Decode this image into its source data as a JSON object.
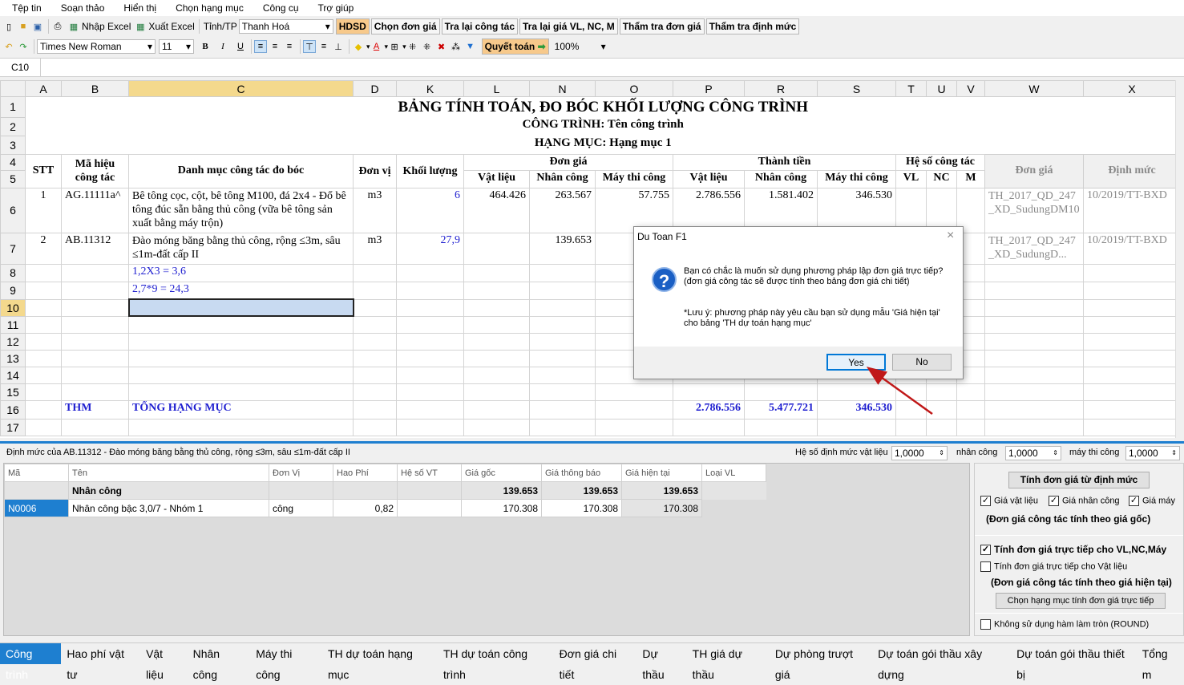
{
  "menu": [
    "Tệp tin",
    "Soạn thảo",
    "Hiển thị",
    "Chọn hạng mục",
    "Công cụ",
    "Trợ giúp"
  ],
  "toolbar1": {
    "import_excel": "Nhập Excel",
    "export_excel": "Xuất Excel",
    "province_label": "Tỉnh/TP",
    "province_value": "Thanh Hoá",
    "buttons": [
      "HDSD",
      "Chọn đơn giá",
      "Tra lại công tác",
      "Tra lại giá VL, NC, M",
      "Thẩm tra đơn giá",
      "Thẩm tra định mức"
    ]
  },
  "toolbar2": {
    "font": "Times New Roman",
    "size": "11",
    "bold": "B",
    "italic": "I",
    "underline": "U",
    "settle": "Quyết toán",
    "zoom": "100%"
  },
  "cell_ref": "C10",
  "columns": [
    "A",
    "B",
    "C",
    "D",
    "K",
    "L",
    "N",
    "O",
    "P",
    "R",
    "S",
    "T",
    "U",
    "V",
    "W",
    "X"
  ],
  "rows": [
    "1",
    "2",
    "3",
    "4",
    "5",
    "6",
    "7",
    "8",
    "9",
    "10",
    "11",
    "12",
    "13",
    "14",
    "15",
    "16",
    "17"
  ],
  "sheet": {
    "title": "BẢNG TÍNH TOÁN, ĐO BÓC KHỐI LƯỢNG CÔNG TRÌNH",
    "project": "CÔNG TRÌNH: Tên công trình",
    "category": "HẠNG MỤC: Hạng mục 1",
    "h": {
      "stt": "STT",
      "code": "Mã hiệu công tác",
      "name": "Danh mục công tác đo bóc",
      "unit": "Đơn vị",
      "qty": "Khối lượng",
      "unit_price": "Đơn giá",
      "amount": "Thành tiền",
      "coef": "Hệ số công tác",
      "vl": "Vật liệu",
      "nc": "Nhân công",
      "m": "Máy thi công",
      "cvl": "VL",
      "cnc": "NC",
      "cm": "M",
      "w": "Đơn giá",
      "x": "Định mức"
    },
    "r1": {
      "stt": "1",
      "code": "AG.11111a^",
      "name": "Bê tông cọc, cột, bê tông M100, đá 2x4 - Đổ bê tông đúc sẵn bằng thủ công (vữa bê tông sản xuất bằng máy trộn)",
      "unit": "m3",
      "qty": "6",
      "vl": "464.426",
      "nc": "263.567",
      "m": "57.755",
      "tvl": "2.786.556",
      "tnc": "1.581.402",
      "tm": "346.530",
      "w": "TH_2017_QD_247_XD_SudungDM10",
      "x": "10/2019/TT-BXD"
    },
    "r2": {
      "stt": "2",
      "code": "AB.11312",
      "name": "Đào móng băng bằng thủ công, rộng ≤3m, sâu ≤1m-đất cấp II",
      "unit": "m3",
      "qty": "27,9",
      "nc": "139.653",
      "w": "TH_2017_QD_247_XD_SudungD...",
      "x": "10/2019/TT-BXD"
    },
    "r8": "1,2X3 = 3,6",
    "r9": "2,7*9 = 24,3",
    "total": {
      "code": "THM",
      "name": "TỔNG HẠNG MỤC",
      "vl": "2.786.556",
      "nc": "5.477.721",
      "m": "346.530"
    }
  },
  "dialog": {
    "title": "Du Toan F1",
    "message": "Bạn có chắc là muốn sử dụng phương pháp lập đơn giá trực tiếp? (đơn giá công tác sẽ được tính theo bảng đơn giá chi tiết)",
    "note": "*Lưu ý: phương pháp này yêu cầu bạn sử dụng mẫu 'Giá hiện tại' cho bảng 'TH dự toán hạng mục'",
    "yes": "Yes",
    "no": "No"
  },
  "detail": {
    "caption": "Định mức của AB.11312 - Đào móng băng bằng thủ công, rộng ≤3m, sâu ≤1m-đất cấp II",
    "coef_vl_label": "Hệ số định mức vật liệu",
    "coef_vl": "1,0000",
    "coef_nc_label": "nhân công",
    "coef_nc": "1,0000",
    "coef_m_label": "máy thi công",
    "coef_m": "1,0000",
    "cols": [
      "Mã",
      "Tên",
      "Đơn Vị",
      "Hao Phí",
      "Hệ số VT",
      "Giá gốc",
      "Giá thông báo",
      "Giá hiện tại",
      "Loại VL"
    ],
    "group": {
      "name": "Nhân công",
      "p1": "139.653",
      "p2": "139.653",
      "p3": "139.653"
    },
    "row": {
      "code": "N0006",
      "name": "Nhân công bậc 3,0/7 - Nhóm 1",
      "unit": "công",
      "hp": "0,82",
      "p1": "170.308",
      "p2": "170.308",
      "p3": "170.308"
    }
  },
  "right": {
    "calc_btn": "Tính đơn giá từ định mức",
    "c1": "Giá vật liệu",
    "c2": "Giá nhân công",
    "c3": "Giá máy",
    "note1": "(Đơn giá công tác tính theo giá gốc)",
    "direct": "Tính đơn giá trực tiếp cho VL,NC,Máy",
    "direct_vl": "Tính đơn giá trực tiếp cho Vật liệu",
    "note2": "(Đơn giá công tác tính theo giá hiện tại)",
    "choose_btn": "Chọn hạng mục tính đơn giá trực tiếp",
    "round": "Không sử dụng hàm làm tròn (ROUND)"
  },
  "tabs": [
    "Công trình",
    "Hao phí vật tư",
    "Vật liệu",
    "Nhân công",
    "Máy thi công",
    "TH dự toán hạng mục",
    "TH dự toán công trình",
    "Đơn giá chi tiết",
    "Dự thầu",
    "TH giá dự thầu",
    "Dự phòng trượt giá",
    "Dự toán gói thầu xây dựng",
    "Dự toán gói thầu thiết bị",
    "Tổng m"
  ]
}
